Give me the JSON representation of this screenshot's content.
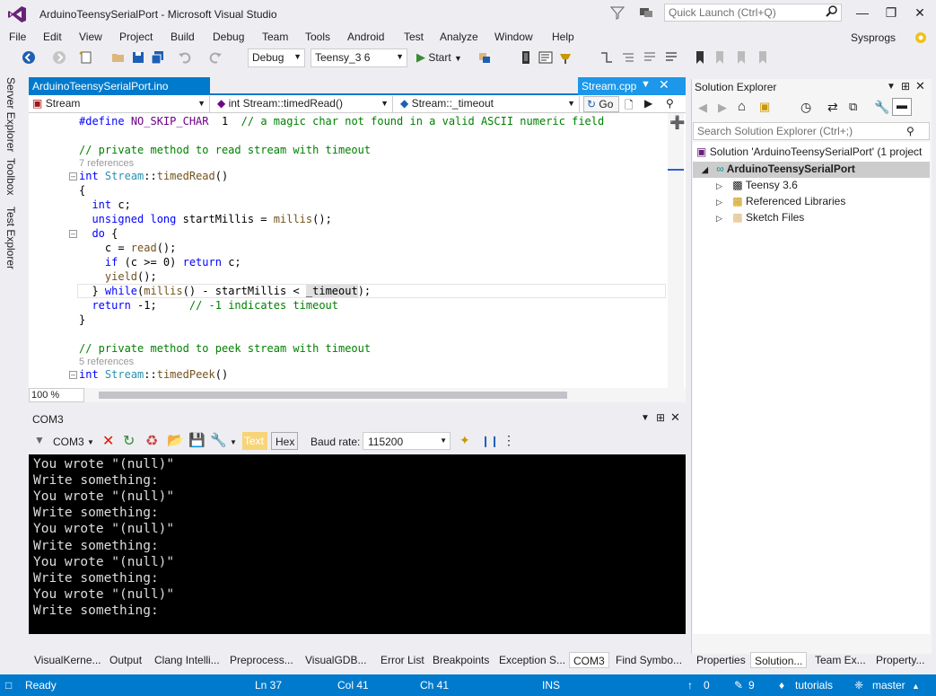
{
  "window": {
    "title": "ArduinoTeensySerialPort - Microsoft Visual Studio",
    "quick_launch_placeholder": "Quick Launch (Ctrl+Q)",
    "user": "Sysprogs"
  },
  "menu": [
    "File",
    "Edit",
    "View",
    "Project",
    "Build",
    "Debug",
    "Team",
    "Tools",
    "Android",
    "Test",
    "Analyze",
    "Window",
    "Help"
  ],
  "toolbar": {
    "config": "Debug",
    "platform": "Teensy_3 6",
    "start_label": "Start"
  },
  "left_tabs": [
    "Server Explorer",
    "Toolbox",
    "Test Explorer"
  ],
  "doc_tabs": {
    "first": "ArduinoTeensySerialPort.ino",
    "active": "Stream.cpp"
  },
  "navbar": {
    "scope": "Stream",
    "member": "int Stream::timedRead()",
    "symbol": "Stream::_timeout",
    "go": "Go"
  },
  "editor": {
    "refs_a": "7 references",
    "refs_b": "5 references",
    "zoom": "100 %"
  },
  "com": {
    "title": "COM3",
    "port": "COM3",
    "text_btn": "Text",
    "hex_btn": "Hex",
    "baud_label": "Baud rate:",
    "baud_value": "115200",
    "lines": [
      "You wrote \"(null)\"",
      "Write something:",
      "You wrote \"(null)\"",
      "Write something:",
      "You wrote \"(null)\"",
      "Write something:",
      "You wrote \"(null)\"",
      "Write something:",
      "You wrote \"(null)\"",
      "Write something:"
    ]
  },
  "bottom_tabs": [
    "VisualKerne...",
    "Output",
    "Clang Intelli...",
    "Preprocess...",
    "VisualGDB...",
    "Error List",
    "Breakpoints",
    "Exception S...",
    "COM3",
    "Find Symbo..."
  ],
  "solution_explorer": {
    "title": "Solution Explorer",
    "search_placeholder": "Search Solution Explorer (Ctrl+;)",
    "solution": "Solution 'ArduinoTeensySerialPort' (1 project",
    "project": "ArduinoTeensySerialPort",
    "children": [
      "Teensy 3.6",
      "Referenced Libraries",
      "Sketch Files"
    ],
    "tabs": [
      "Properties",
      "Solution...",
      "Team Ex...",
      "Property..."
    ]
  },
  "status": {
    "ready": "Ready",
    "ln": "Ln 37",
    "col": "Col 41",
    "ch": "Ch 41",
    "ins": "INS",
    "up_count": "0",
    "edit_count": "9",
    "repo": "tutorials",
    "branch": "master"
  }
}
